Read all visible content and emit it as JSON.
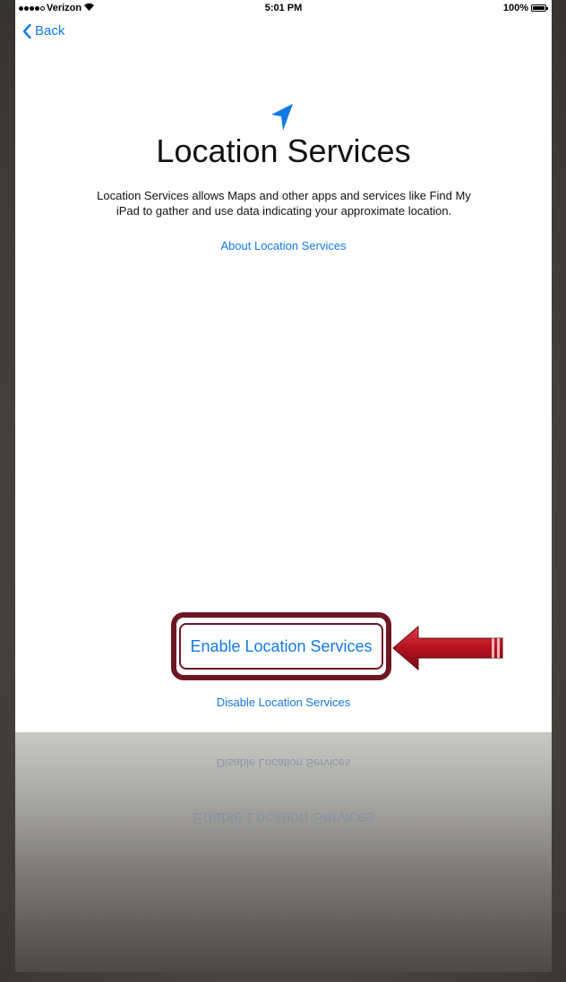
{
  "status_bar": {
    "carrier": "Verizon",
    "signal_bars_filled": 4,
    "signal_bars_total": 5,
    "time": "5:01 PM",
    "battery_label": "100%",
    "battery_level": 1.0
  },
  "nav": {
    "back_label": "Back"
  },
  "main": {
    "icon": "location-arrow-icon",
    "title": "Location Services",
    "description": "Location Services allows Maps and other apps and services like Find My iPad to gather and use data indicating your approximate location.",
    "about_link": "About Location Services"
  },
  "actions": {
    "enable_label": "Enable Location Services",
    "disable_label": "Disable Location Services"
  },
  "reflection": {
    "disable_label": "Disable Location Services",
    "enable_label": "Enable Location Services"
  },
  "colors": {
    "link_blue": "#1279e6",
    "highlight_frame": "#6e1723",
    "callout_arrow": "#b3121f"
  }
}
